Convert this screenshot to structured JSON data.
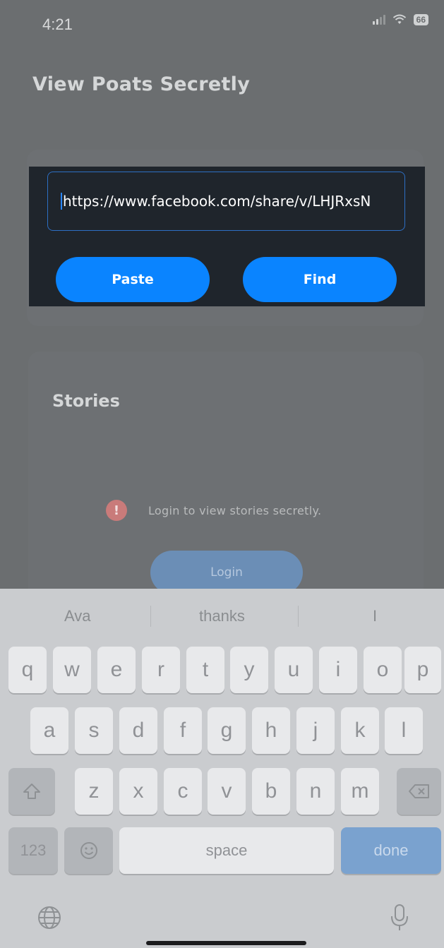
{
  "status_bar": {
    "time": "4:21",
    "battery": "66"
  },
  "page_title": "View Poats Secretly",
  "search": {
    "url_value": "https://www.facebook.com/share/v/LHJRxsN",
    "paste_label": "Paste",
    "find_label": "Find"
  },
  "stories": {
    "title": "Stories",
    "notice_icon": "!",
    "notice": "Login to view stories secretly.",
    "login_label": "Login"
  },
  "keyboard": {
    "suggestions": [
      "Ava",
      "thanks",
      "I"
    ],
    "row1": [
      "q",
      "w",
      "e",
      "r",
      "t",
      "y",
      "u",
      "i",
      "o",
      "p"
    ],
    "row2": [
      "a",
      "s",
      "d",
      "f",
      "g",
      "h",
      "j",
      "k",
      "l"
    ],
    "row3": [
      "z",
      "x",
      "c",
      "v",
      "b",
      "n",
      "m"
    ],
    "numbers_label": "123",
    "space_label": "space",
    "done_label": "done"
  },
  "colors": {
    "accent": "#0a84ff",
    "panel": "#1f252c",
    "overlay": "#6b6e70"
  }
}
